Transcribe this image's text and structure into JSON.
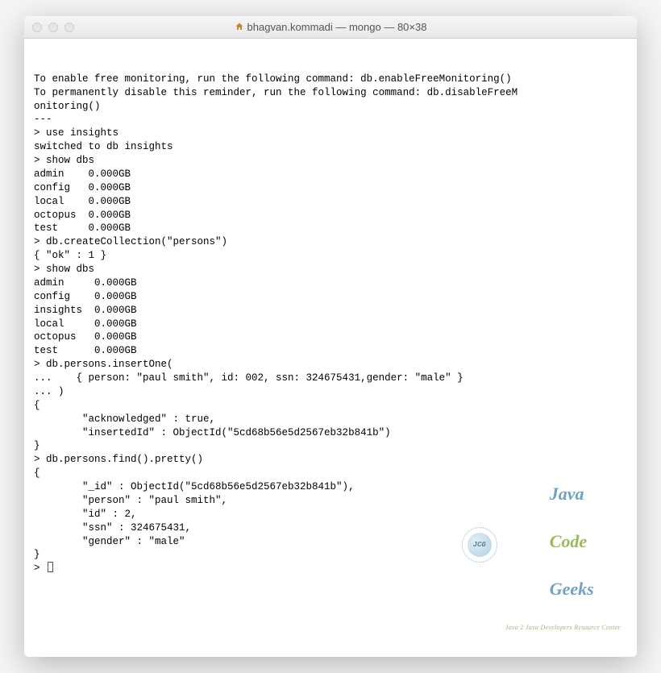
{
  "window": {
    "title": "bhagvan.kommadi — mongo — 80×38"
  },
  "terminal": {
    "lines": [
      "To enable free monitoring, run the following command: db.enableFreeMonitoring()",
      "To permanently disable this reminder, run the following command: db.disableFreeM",
      "onitoring()",
      "---",
      "",
      "> use insights",
      "switched to db insights",
      "> show dbs",
      "admin    0.000GB",
      "config   0.000GB",
      "local    0.000GB",
      "octopus  0.000GB",
      "test     0.000GB",
      "> db.createCollection(\"persons\")",
      "{ \"ok\" : 1 }",
      "> show dbs",
      "admin     0.000GB",
      "config    0.000GB",
      "insights  0.000GB",
      "local     0.000GB",
      "octopus   0.000GB",
      "test      0.000GB",
      "> db.persons.insertOne(",
      "...    { person: \"paul smith\", id: 002, ssn: 324675431,gender: \"male\" }",
      "... )",
      "{",
      "        \"acknowledged\" : true,",
      "        \"insertedId\" : ObjectId(\"5cd68b56e5d2567eb32b841b\")",
      "}",
      "> db.persons.find().pretty()",
      "{",
      "        \"_id\" : ObjectId(\"5cd68b56e5d2567eb32b841b\"),",
      "        \"person\" : \"paul smith\",",
      "        \"id\" : 2,",
      "        \"ssn\" : 324675431,",
      "        \"gender\" : \"male\"",
      "}",
      "> "
    ],
    "prompt": "> "
  },
  "watermark": {
    "badge": "JCG",
    "main_java": "Java",
    "main_code": "Code",
    "main_geeks": "Geeks",
    "sub": "Java 2 Java Developers Resource Center"
  }
}
